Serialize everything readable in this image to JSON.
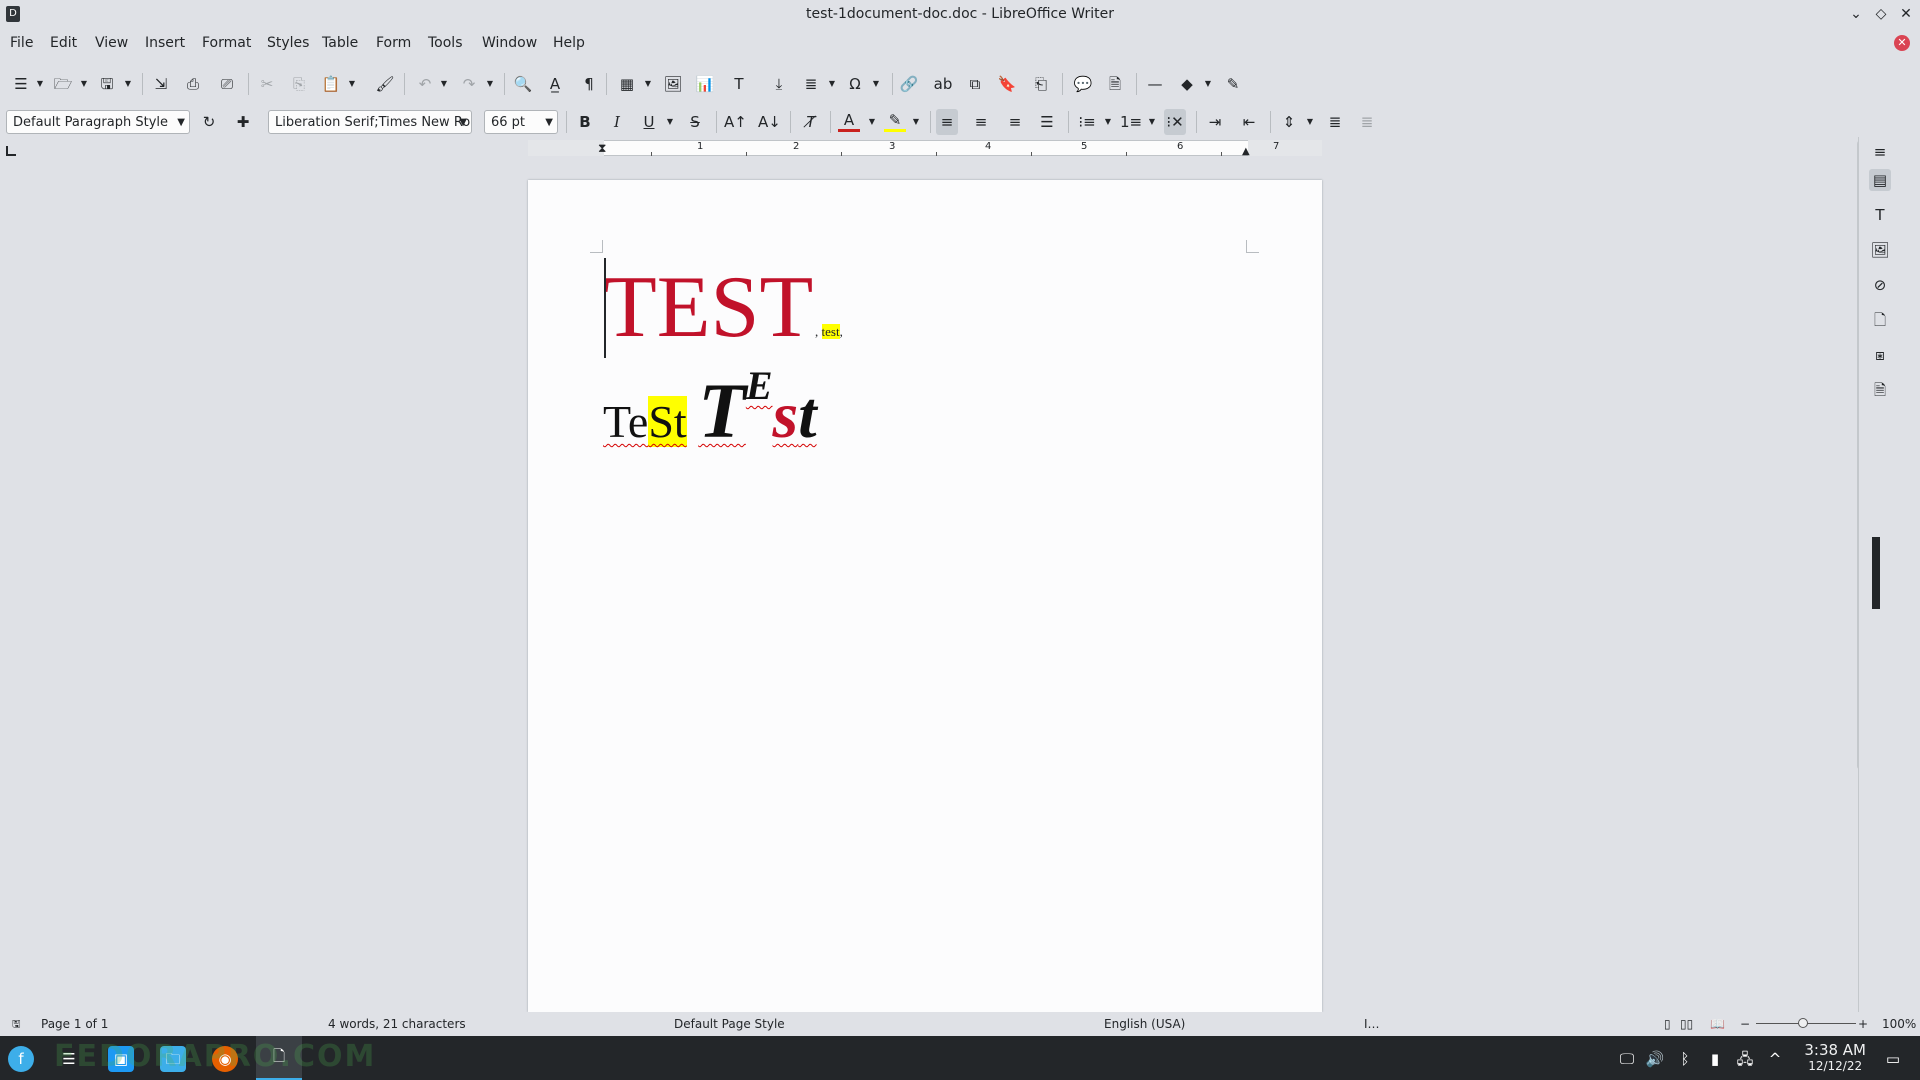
{
  "window": {
    "title": "test-1document-doc.doc - LibreOffice Writer",
    "app_icon": "D"
  },
  "menu": [
    "File",
    "Edit",
    "View",
    "Insert",
    "Format",
    "Styles",
    "Table",
    "Form",
    "Tools",
    "Window",
    "Help"
  ],
  "formatting": {
    "paragraph_style": "Default Paragraph Style",
    "font_name": "Liberation Serif;Times New Roman",
    "font_size": "66 pt"
  },
  "ruler": {
    "numbers": [
      "1",
      "2",
      "3",
      "4",
      "5",
      "6",
      "7"
    ]
  },
  "document": {
    "line1_big": "TEST",
    "line1_small_pre": ",",
    "line1_small_hl": "test",
    "line1_small_post": ",",
    "line2": {
      "a": "Te",
      "b": "St",
      "c": "T",
      "d": "E",
      "e": "s",
      "f": "t"
    }
  },
  "colors": {
    "text_red": "#c1122a",
    "highlight": "#ffff00",
    "font_color_bar": "#c9211e"
  },
  "status": {
    "page": "Page 1 of 1",
    "words": "4 words, 21 characters",
    "page_style": "Default Page Style",
    "language": "English (USA)",
    "zoom": "100%"
  },
  "clock": {
    "time": "3:38 AM",
    "date": "12/12/22"
  },
  "watermark": "FEDORAPRO.COM"
}
